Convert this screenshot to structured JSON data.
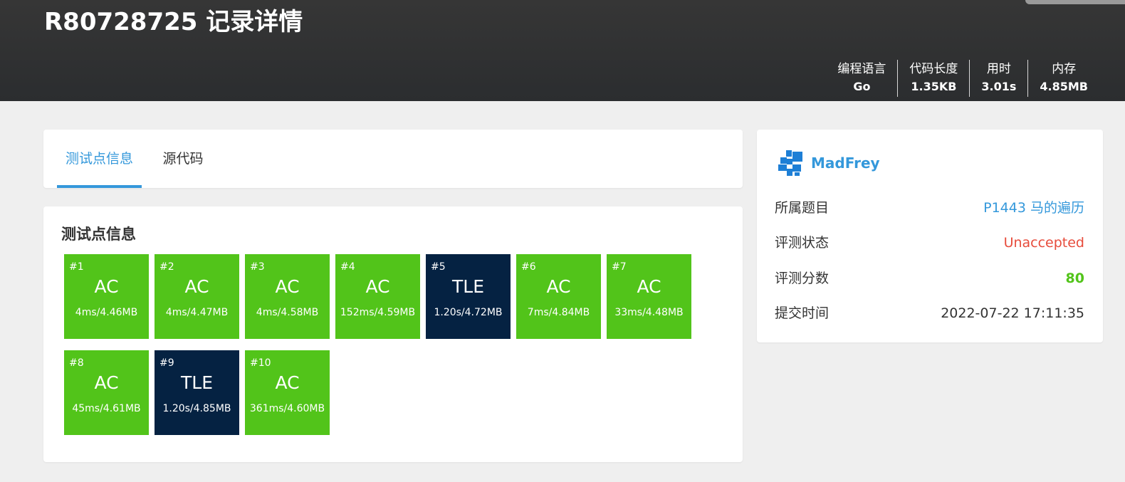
{
  "header": {
    "title": "R80728725 记录详情",
    "stats": [
      {
        "label": "编程语言",
        "value": "Go"
      },
      {
        "label": "代码长度",
        "value": "1.35KB"
      },
      {
        "label": "用时",
        "value": "3.01s"
      },
      {
        "label": "内存",
        "value": "4.85MB"
      }
    ]
  },
  "tabs": {
    "tests_label": "测试点信息",
    "source_label": "源代码",
    "active": "tests"
  },
  "tests": {
    "title": "测试点信息",
    "items": [
      {
        "num": "#1",
        "status": "AC",
        "info": "4ms/4.46MB"
      },
      {
        "num": "#2",
        "status": "AC",
        "info": "4ms/4.47MB"
      },
      {
        "num": "#3",
        "status": "AC",
        "info": "4ms/4.58MB"
      },
      {
        "num": "#4",
        "status": "AC",
        "info": "152ms/4.59MB"
      },
      {
        "num": "#5",
        "status": "TLE",
        "info": "1.20s/4.72MB"
      },
      {
        "num": "#6",
        "status": "AC",
        "info": "7ms/4.84MB"
      },
      {
        "num": "#7",
        "status": "AC",
        "info": "33ms/4.48MB"
      },
      {
        "num": "#8",
        "status": "AC",
        "info": "45ms/4.61MB"
      },
      {
        "num": "#9",
        "status": "TLE",
        "info": "1.20s/4.85MB"
      },
      {
        "num": "#10",
        "status": "AC",
        "info": "361ms/4.60MB"
      }
    ]
  },
  "sidebar": {
    "username": "MadFrey",
    "avatar_icon": "pixel-avatar-icon",
    "rows": [
      {
        "key": "所属题目",
        "value": "P1443 马的遍历"
      },
      {
        "key": "评测状态",
        "value": "Unaccepted"
      },
      {
        "key": "评测分数",
        "value": "80"
      },
      {
        "key": "提交时间",
        "value": "2022-07-22 17:11:35"
      }
    ]
  },
  "colors": {
    "ac": "#52c41a",
    "tle": "#052242",
    "accent": "#3498db",
    "error": "#e74c3c"
  }
}
